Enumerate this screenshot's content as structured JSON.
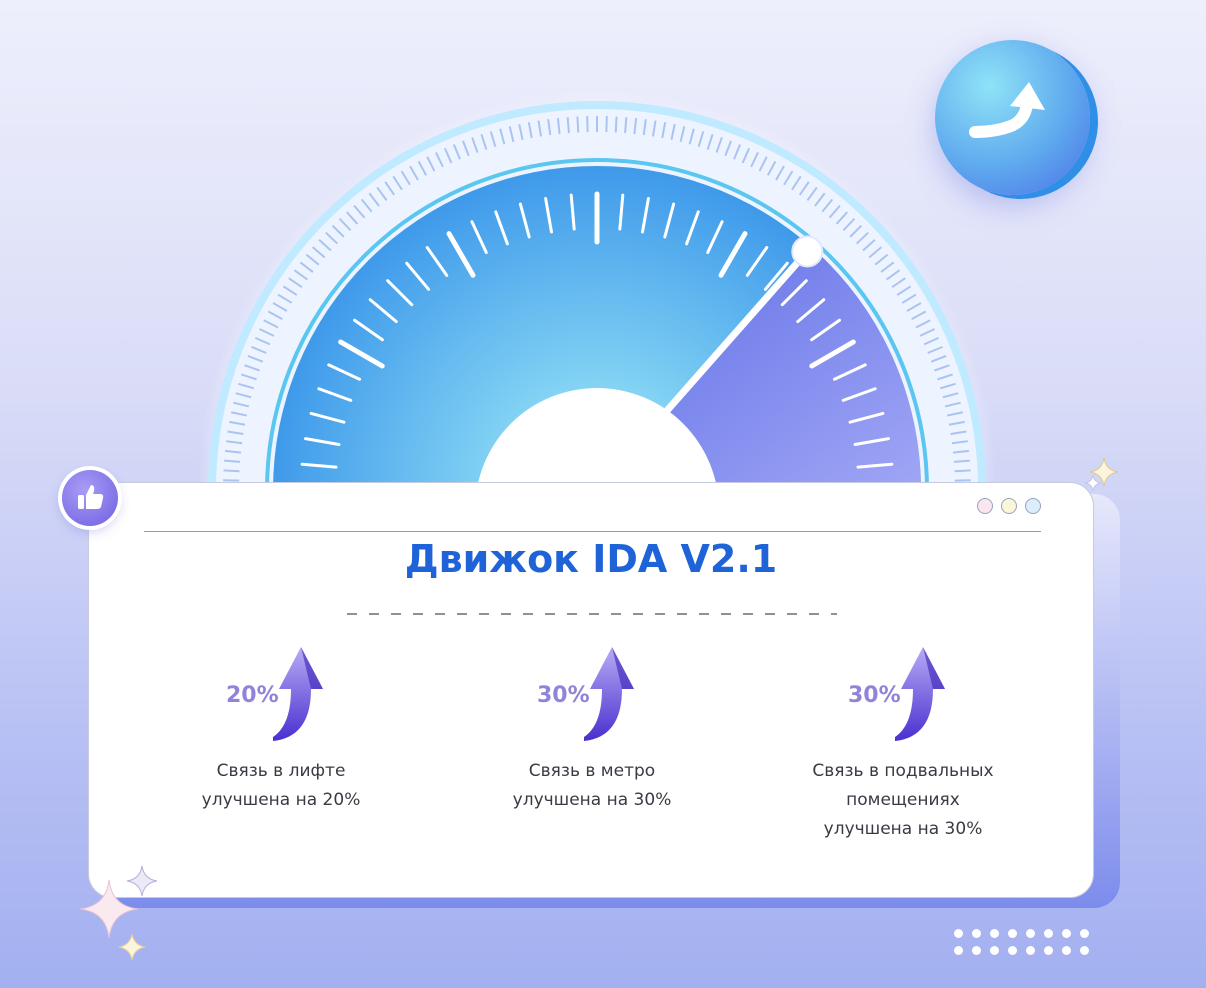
{
  "card": {
    "title": "Движок IDA V2.1",
    "stats": [
      {
        "percent": "20%",
        "caption_lines": [
          "Связь в лифте",
          "улучшена на 20%"
        ]
      },
      {
        "percent": "30%",
        "caption_lines": [
          "Связь в метро",
          "улучшена на 30%"
        ]
      },
      {
        "percent": "30%",
        "caption_lines": [
          "Связь в подвальных",
          "помещениях",
          "улучшена на 30%"
        ]
      }
    ],
    "window_dot_colors": [
      "#fbe6ee",
      "#fbf6d8",
      "#dbeefc"
    ]
  },
  "gauge": {
    "level_fraction": 0.73,
    "accent": "#6f73e6",
    "face": "#4ba6ee"
  },
  "icons": {
    "badge": "curved-up-arrow-icon",
    "thumb": "thumbs-up-icon",
    "stat_arrow": "rising-arrow-icon"
  },
  "colors": {
    "title": "#1e63d8",
    "percent": "#8f84d8"
  }
}
